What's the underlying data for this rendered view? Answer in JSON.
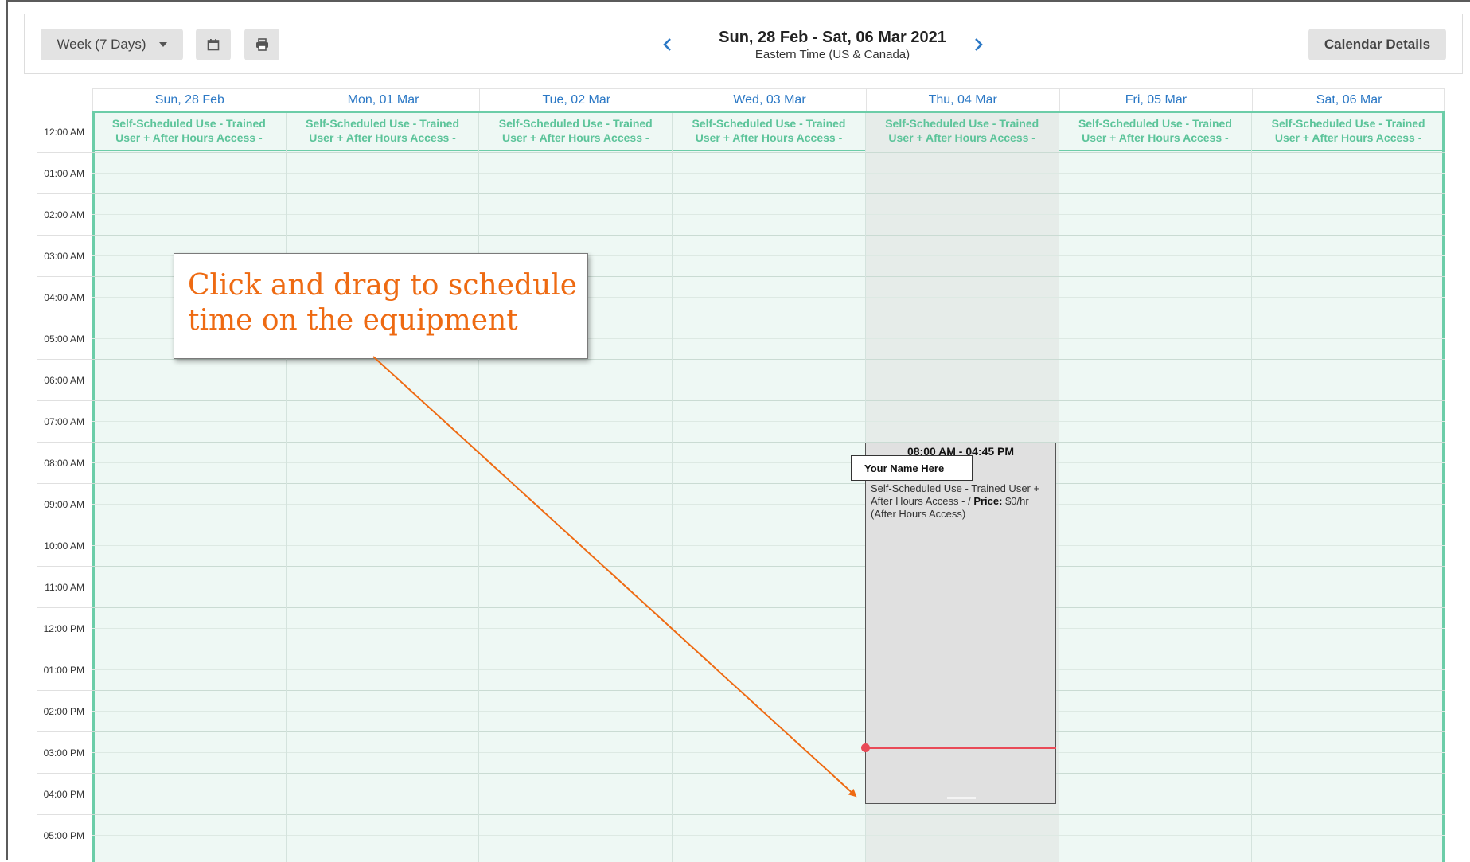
{
  "toolbar": {
    "view_label": "Week (7 Days)",
    "calendar_icon": "calendar-icon",
    "print_icon": "print-icon",
    "range_title": "Sun, 28 Feb - Sat, 06 Mar 2021",
    "timezone": "Eastern Time (US & Canada)",
    "details_label": "Calendar Details"
  },
  "days": [
    "Sun, 28 Feb",
    "Mon, 01 Mar",
    "Tue, 02 Mar",
    "Wed, 03 Mar",
    "Thu, 04 Mar",
    "Fri, 05 Mar",
    "Sat, 06 Mar"
  ],
  "hours": [
    "12:00 AM",
    "01:00 AM",
    "02:00 AM",
    "03:00 AM",
    "04:00 AM",
    "05:00 AM",
    "06:00 AM",
    "07:00 AM",
    "08:00 AM",
    "09:00 AM",
    "10:00 AM",
    "11:00 AM",
    "12:00 PM",
    "01:00 PM",
    "02:00 PM",
    "03:00 PM",
    "04:00 PM",
    "05:00 PM"
  ],
  "availability": {
    "label_line1": "Self-Scheduled Use - Trained",
    "label_line2": "User + After Hours Access -"
  },
  "event": {
    "time": "08:00 AM - 04:45 PM",
    "owner": "Your Name Here",
    "desc_prefix": "Self-Scheduled Use - Trained User + After Hours Access - / ",
    "price_label": "Price:",
    "price_value": " $0/hr (After Hours Access)"
  },
  "callout": {
    "line1": "Click and drag to schedule",
    "line2": "time on the equipment"
  },
  "colors": {
    "accent_blue": "#2b78c5",
    "availability_green": "#6ccda8",
    "callout_orange": "#ee6a12",
    "now_line_red": "#e94a57"
  }
}
